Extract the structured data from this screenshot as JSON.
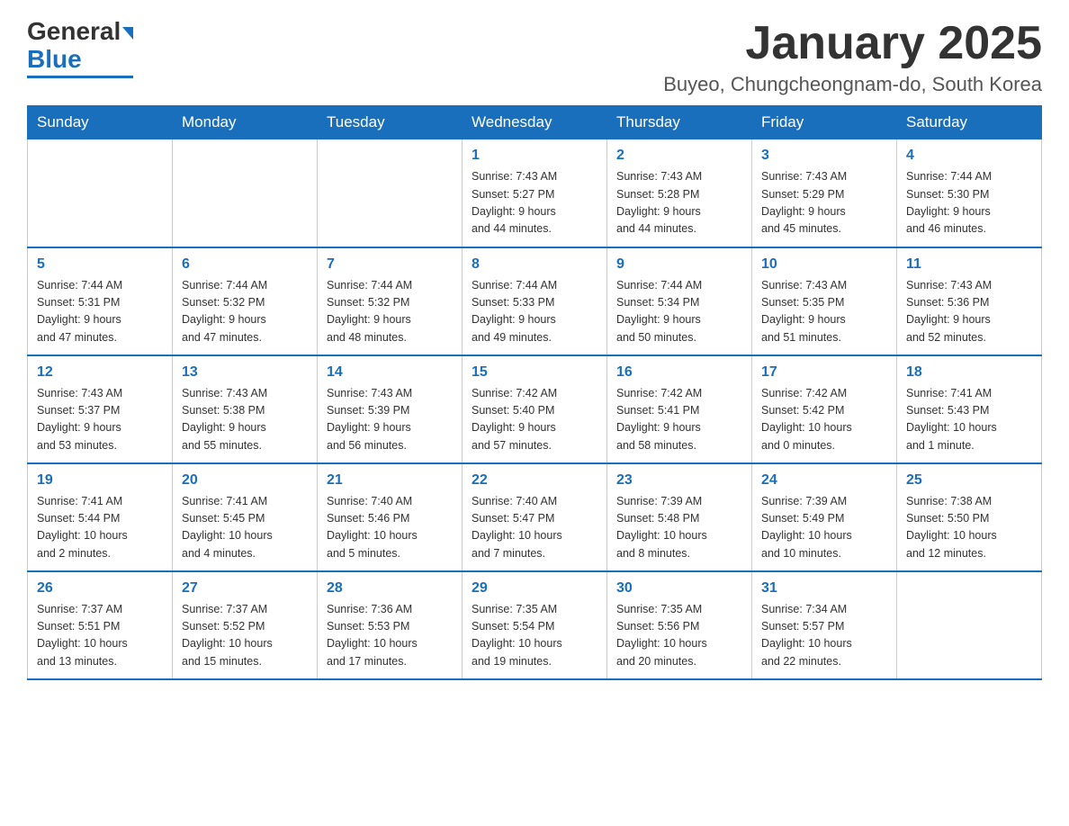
{
  "header": {
    "logo_main": "General",
    "logo_blue": "Blue",
    "title": "January 2025",
    "subtitle": "Buyeo, Chungcheongnam-do, South Korea"
  },
  "days_of_week": [
    "Sunday",
    "Monday",
    "Tuesday",
    "Wednesday",
    "Thursday",
    "Friday",
    "Saturday"
  ],
  "weeks": [
    [
      {
        "day": "",
        "info": ""
      },
      {
        "day": "",
        "info": ""
      },
      {
        "day": "",
        "info": ""
      },
      {
        "day": "1",
        "info": "Sunrise: 7:43 AM\nSunset: 5:27 PM\nDaylight: 9 hours\nand 44 minutes."
      },
      {
        "day": "2",
        "info": "Sunrise: 7:43 AM\nSunset: 5:28 PM\nDaylight: 9 hours\nand 44 minutes."
      },
      {
        "day": "3",
        "info": "Sunrise: 7:43 AM\nSunset: 5:29 PM\nDaylight: 9 hours\nand 45 minutes."
      },
      {
        "day": "4",
        "info": "Sunrise: 7:44 AM\nSunset: 5:30 PM\nDaylight: 9 hours\nand 46 minutes."
      }
    ],
    [
      {
        "day": "5",
        "info": "Sunrise: 7:44 AM\nSunset: 5:31 PM\nDaylight: 9 hours\nand 47 minutes."
      },
      {
        "day": "6",
        "info": "Sunrise: 7:44 AM\nSunset: 5:32 PM\nDaylight: 9 hours\nand 47 minutes."
      },
      {
        "day": "7",
        "info": "Sunrise: 7:44 AM\nSunset: 5:32 PM\nDaylight: 9 hours\nand 48 minutes."
      },
      {
        "day": "8",
        "info": "Sunrise: 7:44 AM\nSunset: 5:33 PM\nDaylight: 9 hours\nand 49 minutes."
      },
      {
        "day": "9",
        "info": "Sunrise: 7:44 AM\nSunset: 5:34 PM\nDaylight: 9 hours\nand 50 minutes."
      },
      {
        "day": "10",
        "info": "Sunrise: 7:43 AM\nSunset: 5:35 PM\nDaylight: 9 hours\nand 51 minutes."
      },
      {
        "day": "11",
        "info": "Sunrise: 7:43 AM\nSunset: 5:36 PM\nDaylight: 9 hours\nand 52 minutes."
      }
    ],
    [
      {
        "day": "12",
        "info": "Sunrise: 7:43 AM\nSunset: 5:37 PM\nDaylight: 9 hours\nand 53 minutes."
      },
      {
        "day": "13",
        "info": "Sunrise: 7:43 AM\nSunset: 5:38 PM\nDaylight: 9 hours\nand 55 minutes."
      },
      {
        "day": "14",
        "info": "Sunrise: 7:43 AM\nSunset: 5:39 PM\nDaylight: 9 hours\nand 56 minutes."
      },
      {
        "day": "15",
        "info": "Sunrise: 7:42 AM\nSunset: 5:40 PM\nDaylight: 9 hours\nand 57 minutes."
      },
      {
        "day": "16",
        "info": "Sunrise: 7:42 AM\nSunset: 5:41 PM\nDaylight: 9 hours\nand 58 minutes."
      },
      {
        "day": "17",
        "info": "Sunrise: 7:42 AM\nSunset: 5:42 PM\nDaylight: 10 hours\nand 0 minutes."
      },
      {
        "day": "18",
        "info": "Sunrise: 7:41 AM\nSunset: 5:43 PM\nDaylight: 10 hours\nand 1 minute."
      }
    ],
    [
      {
        "day": "19",
        "info": "Sunrise: 7:41 AM\nSunset: 5:44 PM\nDaylight: 10 hours\nand 2 minutes."
      },
      {
        "day": "20",
        "info": "Sunrise: 7:41 AM\nSunset: 5:45 PM\nDaylight: 10 hours\nand 4 minutes."
      },
      {
        "day": "21",
        "info": "Sunrise: 7:40 AM\nSunset: 5:46 PM\nDaylight: 10 hours\nand 5 minutes."
      },
      {
        "day": "22",
        "info": "Sunrise: 7:40 AM\nSunset: 5:47 PM\nDaylight: 10 hours\nand 7 minutes."
      },
      {
        "day": "23",
        "info": "Sunrise: 7:39 AM\nSunset: 5:48 PM\nDaylight: 10 hours\nand 8 minutes."
      },
      {
        "day": "24",
        "info": "Sunrise: 7:39 AM\nSunset: 5:49 PM\nDaylight: 10 hours\nand 10 minutes."
      },
      {
        "day": "25",
        "info": "Sunrise: 7:38 AM\nSunset: 5:50 PM\nDaylight: 10 hours\nand 12 minutes."
      }
    ],
    [
      {
        "day": "26",
        "info": "Sunrise: 7:37 AM\nSunset: 5:51 PM\nDaylight: 10 hours\nand 13 minutes."
      },
      {
        "day": "27",
        "info": "Sunrise: 7:37 AM\nSunset: 5:52 PM\nDaylight: 10 hours\nand 15 minutes."
      },
      {
        "day": "28",
        "info": "Sunrise: 7:36 AM\nSunset: 5:53 PM\nDaylight: 10 hours\nand 17 minutes."
      },
      {
        "day": "29",
        "info": "Sunrise: 7:35 AM\nSunset: 5:54 PM\nDaylight: 10 hours\nand 19 minutes."
      },
      {
        "day": "30",
        "info": "Sunrise: 7:35 AM\nSunset: 5:56 PM\nDaylight: 10 hours\nand 20 minutes."
      },
      {
        "day": "31",
        "info": "Sunrise: 7:34 AM\nSunset: 5:57 PM\nDaylight: 10 hours\nand 22 minutes."
      },
      {
        "day": "",
        "info": ""
      }
    ]
  ]
}
